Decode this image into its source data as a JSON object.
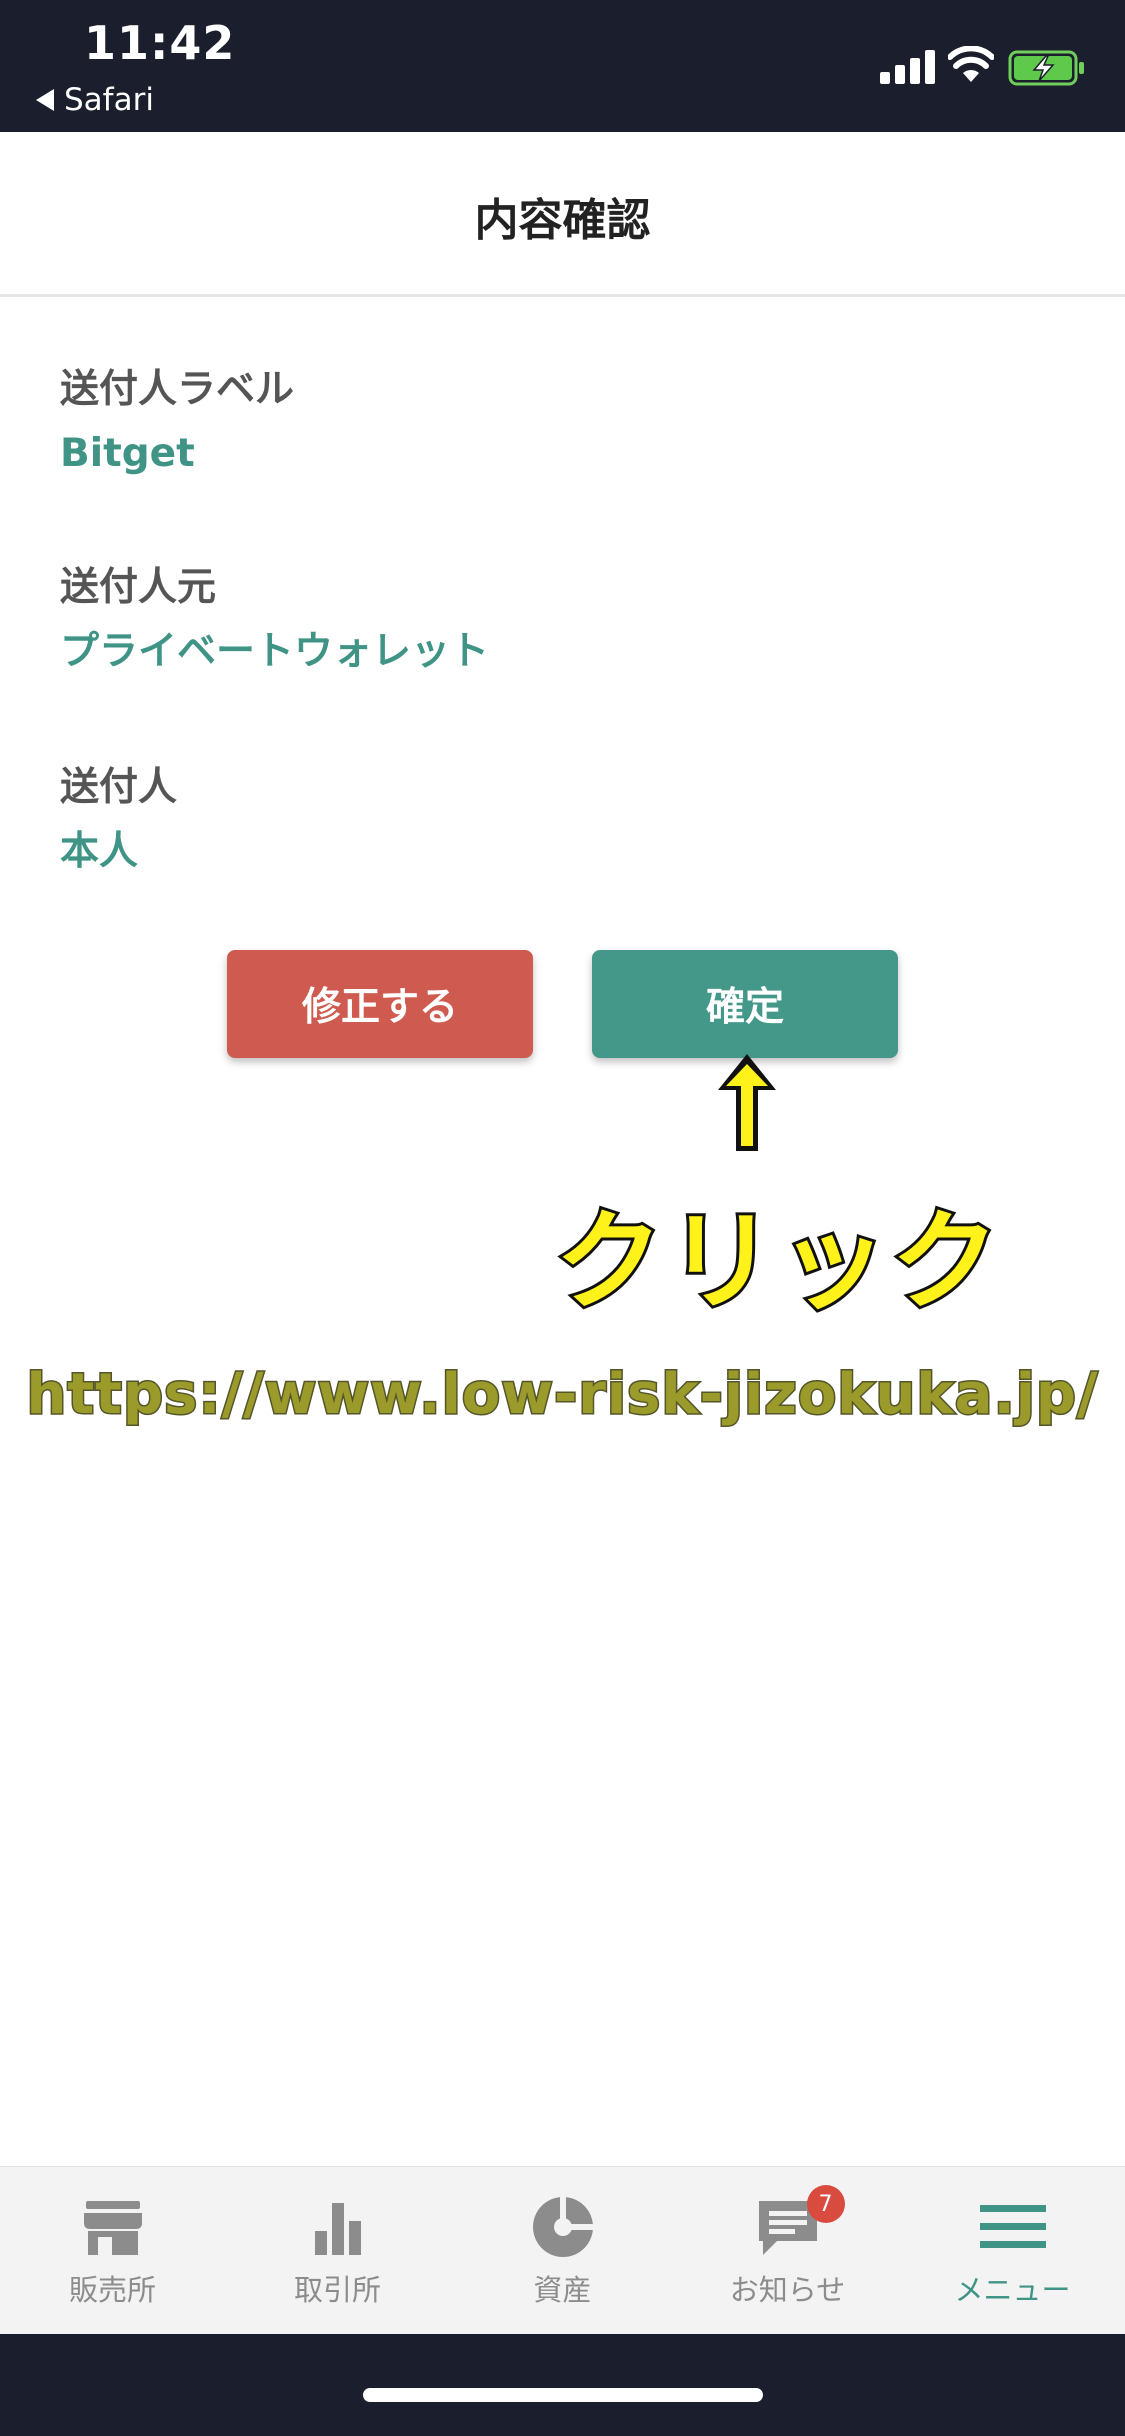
{
  "status_bar": {
    "time": "11:42",
    "back_label": "Safari"
  },
  "header": {
    "title": "内容確認"
  },
  "fields": [
    {
      "label": "送付人ラベル",
      "value": "Bitget"
    },
    {
      "label": "送付人元",
      "value": "プライベートウォレット"
    },
    {
      "label": "送付人",
      "value": "本人"
    }
  ],
  "buttons": {
    "modify_label": "修正する",
    "confirm_label": "確定"
  },
  "annotation": {
    "click_text": "クリック",
    "watermark_url": "https://www.low-risk-jizokuka.jp/"
  },
  "tabbar": {
    "items": [
      {
        "label": "販売所",
        "icon": "store-icon"
      },
      {
        "label": "取引所",
        "icon": "bar-chart-icon"
      },
      {
        "label": "資産",
        "icon": "pie-chart-icon"
      },
      {
        "label": "お知らせ",
        "icon": "message-icon",
        "badge": "7"
      },
      {
        "label": "メニュー",
        "icon": "menu-icon",
        "active": true
      }
    ]
  },
  "colors": {
    "status_bar_bg": "#1b1e2c",
    "accent_green": "#3f9485",
    "confirm_button": "#44988a",
    "modify_button": "#cf5a4f",
    "badge_red": "#d94a3f",
    "click_text_yellow": "#fff21a"
  }
}
